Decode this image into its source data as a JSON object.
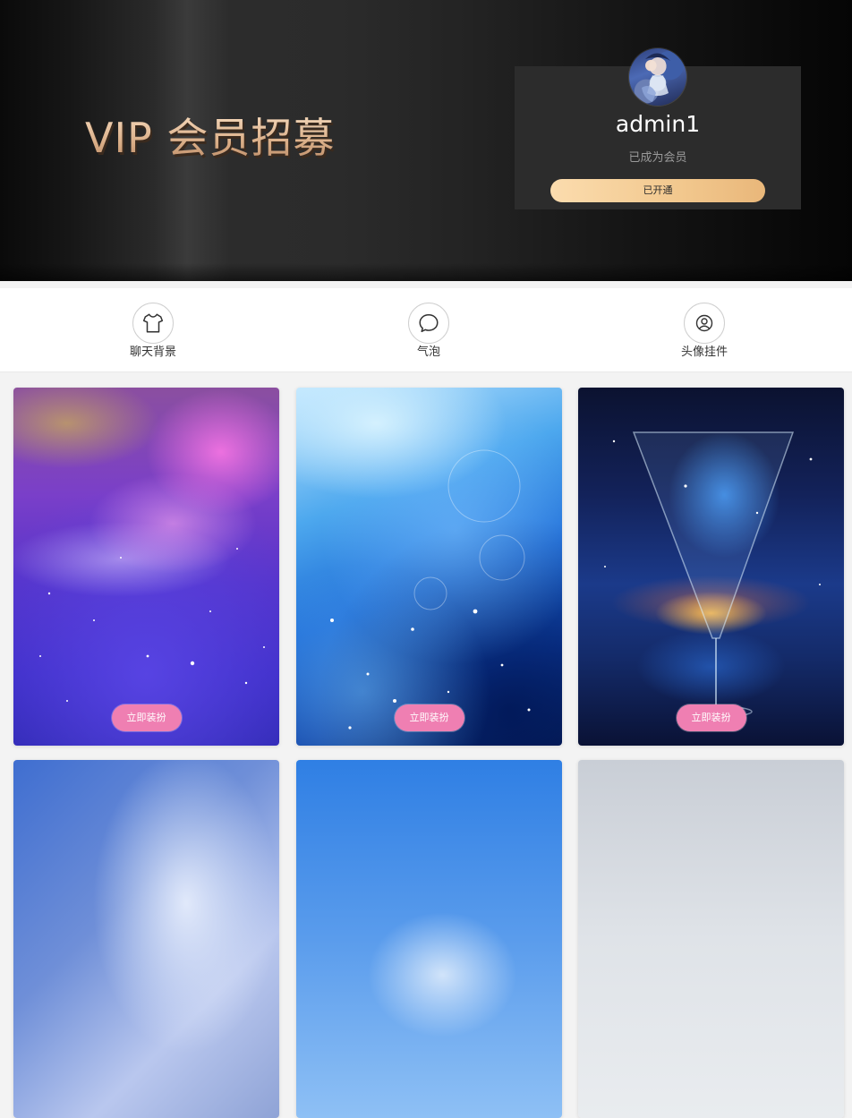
{
  "hero": {
    "title": "VIP 会员招募",
    "username": "admin1",
    "member_status": "已成为会员",
    "open_button_label": "已开通"
  },
  "categories": [
    {
      "label": "聊天背景",
      "icon": "shirt-icon"
    },
    {
      "label": "气泡",
      "icon": "chat-bubble-icon"
    },
    {
      "label": "头像挂件",
      "icon": "user-circle-icon"
    }
  ],
  "cards": [
    {
      "action_label": "立即装扮",
      "image": "purple-nebula"
    },
    {
      "action_label": "立即装扮",
      "image": "blue-light-streaks"
    },
    {
      "action_label": "立即装扮",
      "image": "cosmic-cocktail-glass"
    },
    {
      "action_label": "",
      "image": "blue-white-clouds"
    },
    {
      "action_label": "",
      "image": "blue-sky"
    },
    {
      "action_label": "",
      "image": "grey-sky"
    }
  ],
  "colors": {
    "accent_pink": "#ef7fb2",
    "gold_button": "#f2c88e",
    "title_gold": "#e8c3a0"
  }
}
